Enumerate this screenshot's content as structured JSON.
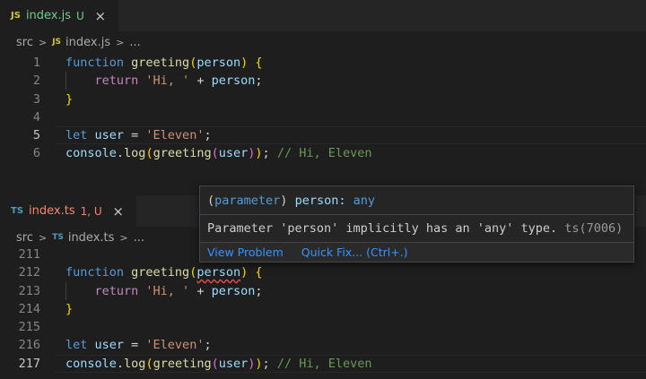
{
  "editor1": {
    "tab": {
      "lang_badge": "JS",
      "filename": "index.js",
      "status": "U",
      "close": "×"
    },
    "breadcrumb": {
      "folder": "src",
      "sep": ">",
      "lang_badge": "JS",
      "file": "index.js",
      "more": "..."
    },
    "lines": [
      {
        "num": "1",
        "tokens": [
          [
            "kw",
            "function "
          ],
          [
            "fn",
            "greeting"
          ],
          [
            "b1",
            "("
          ],
          [
            "pm",
            "person"
          ],
          [
            "b1",
            ")"
          ],
          [
            "pn",
            " "
          ],
          [
            "b1",
            "{"
          ]
        ]
      },
      {
        "num": "2",
        "tokens": [
          [
            "pn",
            "    "
          ],
          [
            "kc",
            "return "
          ],
          [
            "st",
            "'Hi, '"
          ],
          [
            "pn",
            " + "
          ],
          [
            "pm",
            "person"
          ],
          [
            "pn",
            ";"
          ]
        ]
      },
      {
        "num": "3",
        "tokens": [
          [
            "b1",
            "}"
          ]
        ]
      },
      {
        "num": "4",
        "tokens": []
      },
      {
        "num": "5",
        "tokens": [
          [
            "kw",
            "let "
          ],
          [
            "pm",
            "user"
          ],
          [
            "pn",
            " = "
          ],
          [
            "st",
            "'Eleven'"
          ],
          [
            "pn",
            ";"
          ]
        ]
      },
      {
        "num": "6",
        "tokens": [
          [
            "pm",
            "console"
          ],
          [
            "pn",
            "."
          ],
          [
            "fn",
            "log"
          ],
          [
            "b1",
            "("
          ],
          [
            "fn",
            "greeting"
          ],
          [
            "b2",
            "("
          ],
          [
            "pm",
            "user"
          ],
          [
            "b2",
            ")"
          ],
          [
            "b1",
            ")"
          ],
          [
            "pn",
            "; "
          ],
          [
            "cm",
            "// Hi, Eleven"
          ]
        ]
      }
    ]
  },
  "editor2": {
    "tab": {
      "lang_badge": "TS",
      "filename": "index.ts",
      "status": "1, U",
      "close": "×"
    },
    "breadcrumb": {
      "folder": "src",
      "sep": ">",
      "lang_badge": "TS",
      "file": "index.ts",
      "more": "..."
    },
    "lines": [
      {
        "num": "211",
        "tokens": []
      },
      {
        "num": "212",
        "tokens": [
          [
            "kw",
            "function "
          ],
          [
            "fn",
            "greeting"
          ],
          [
            "b1",
            "("
          ],
          [
            "pm squig",
            "person"
          ],
          [
            "b1",
            ")"
          ],
          [
            "pn",
            " "
          ],
          [
            "b1",
            "{"
          ]
        ]
      },
      {
        "num": "213",
        "tokens": [
          [
            "pn",
            "    "
          ],
          [
            "kc",
            "return "
          ],
          [
            "st",
            "'Hi, '"
          ],
          [
            "pn",
            " + "
          ],
          [
            "pm",
            "person"
          ],
          [
            "pn",
            ";"
          ]
        ]
      },
      {
        "num": "214",
        "tokens": [
          [
            "b1",
            "}"
          ]
        ]
      },
      {
        "num": "215",
        "tokens": []
      },
      {
        "num": "216",
        "tokens": [
          [
            "kw",
            "let "
          ],
          [
            "pm",
            "user"
          ],
          [
            "pn",
            " = "
          ],
          [
            "st",
            "'Eleven'"
          ],
          [
            "pn",
            ";"
          ]
        ]
      },
      {
        "num": "217",
        "tokens": [
          [
            "pm",
            "console"
          ],
          [
            "pn",
            "."
          ],
          [
            "fn",
            "log"
          ],
          [
            "b1",
            "("
          ],
          [
            "fn",
            "greeting"
          ],
          [
            "b2",
            "("
          ],
          [
            "pm",
            "user"
          ],
          [
            "b2",
            ")"
          ],
          [
            "b1",
            ")"
          ],
          [
            "pn",
            "; "
          ],
          [
            "cm",
            "// Hi, Eleven"
          ]
        ]
      }
    ]
  },
  "hover": {
    "sig_open": "(",
    "sig_kind": "parameter",
    "sig_close": ")",
    "sig_name": " person: ",
    "sig_type": "any",
    "message": "Parameter 'person' implicitly has an 'any' type.",
    "code": " ts(7006)",
    "view_problem": "View Problem",
    "quick_fix": "Quick Fix... (Ctrl+.)"
  },
  "colors": {
    "js_badge": "#cbcb41",
    "ts_badge": "#519aba",
    "js_tab_text": "#73c991",
    "ts_tab_text": "#f48771",
    "link": "#3794ff"
  }
}
